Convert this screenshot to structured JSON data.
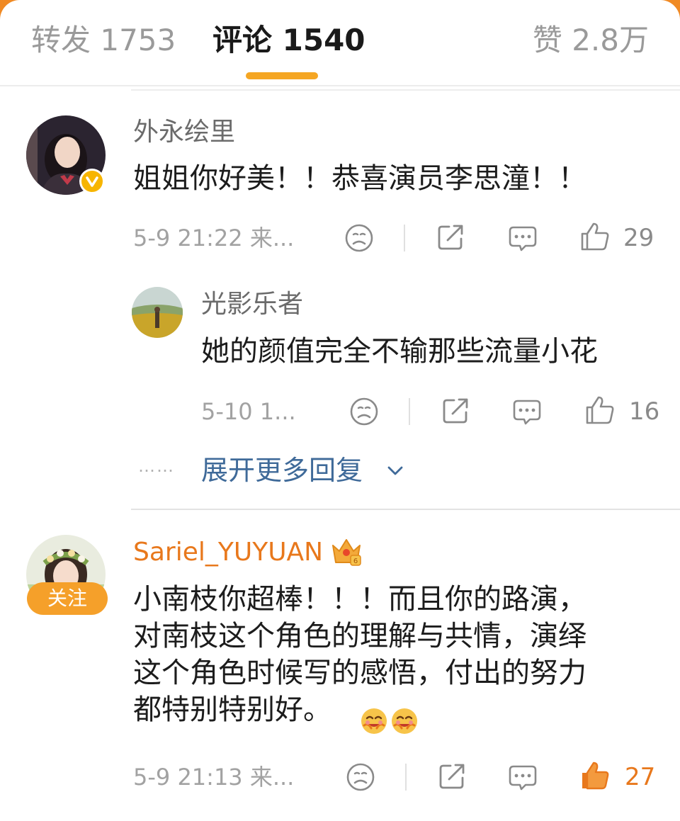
{
  "tabs": {
    "repost": "转发 1753",
    "comment": "评论 1540",
    "likes": "赞 2.8万"
  },
  "comments": [
    {
      "user": "外永绘里",
      "text": "姐姐你好美！！恭喜演员李思潼！！",
      "time": "5-9 21:22 来...",
      "like_count": "29",
      "verified": true
    },
    {
      "user": "光影乐者",
      "text": "她的颜值完全不输那些流量小花",
      "time": "5-10 1...",
      "like_count": "16"
    },
    {
      "user": "Sariel_YUYUAN",
      "text_line1": "小南枝你超棒！！！而且你的路演，",
      "text_line2": "对南枝这个角色的理解与共情，演绎",
      "text_line3": "这个角色时候写的感悟，付出的努力",
      "text_line4": "都特别特别好。",
      "time": "5-9 21:13 来...",
      "like_count": "27",
      "follow_label": "关注",
      "liked": true
    }
  ],
  "expand_replies": {
    "dots": "……",
    "label": "展开更多回复"
  },
  "colors": {
    "accent": "#f5a623",
    "liked": "#e8781c",
    "link": "#3f6a99"
  },
  "icons": [
    "dislike-icon",
    "share-icon",
    "comment-icon",
    "like-icon",
    "chevron-down-icon",
    "crown-icon",
    "hug-emoji-icon"
  ]
}
